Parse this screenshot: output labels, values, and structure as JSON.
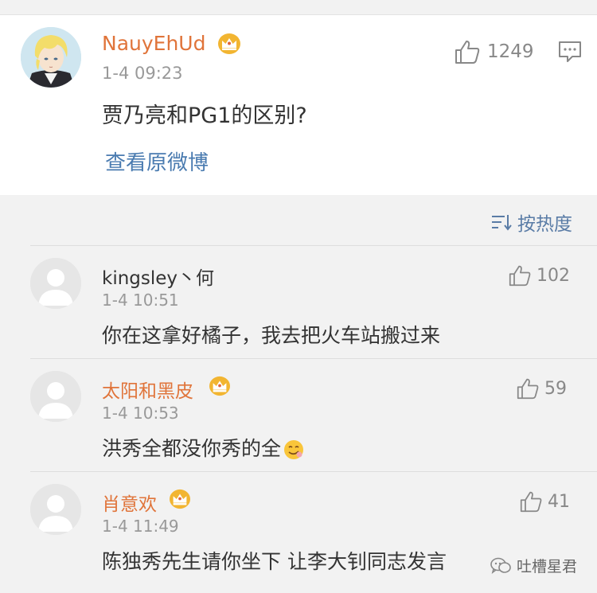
{
  "main_post": {
    "username": "NauyEhUd",
    "timestamp": "1-4 09:23",
    "content": "贾乃亮和PG1的区别?",
    "view_original": "查看原微博",
    "like_count": "1249"
  },
  "sort": {
    "label": "按热度"
  },
  "comments": [
    {
      "username": "kingsley丶何",
      "timestamp": "1-4 10:51",
      "content": "你在这拿好橘子，我去把火车站搬过来",
      "like_count": "102",
      "vip": false
    },
    {
      "username": "太阳和黑皮",
      "timestamp": "1-4 10:53",
      "content": "洪秀全都没你秀的全",
      "like_count": "59",
      "vip": true
    },
    {
      "username": "肖意欢",
      "timestamp": "1-4 11:49",
      "content": "陈独秀先生请你坐下 让李大钊同志发言",
      "like_count": "41",
      "vip": true
    }
  ],
  "watermark": {
    "text": "吐槽星君"
  },
  "colors": {
    "vip_name": "#e0743a",
    "link": "#4a7bb0",
    "sort": "#5a7ca6",
    "crown": "#f2b531"
  },
  "icons": {
    "like": "thumbs-up-outline",
    "comment": "speech-bubble-outline",
    "vip": "crown-badge",
    "sort": "sort-lines",
    "watermark": "wechat-logo"
  }
}
